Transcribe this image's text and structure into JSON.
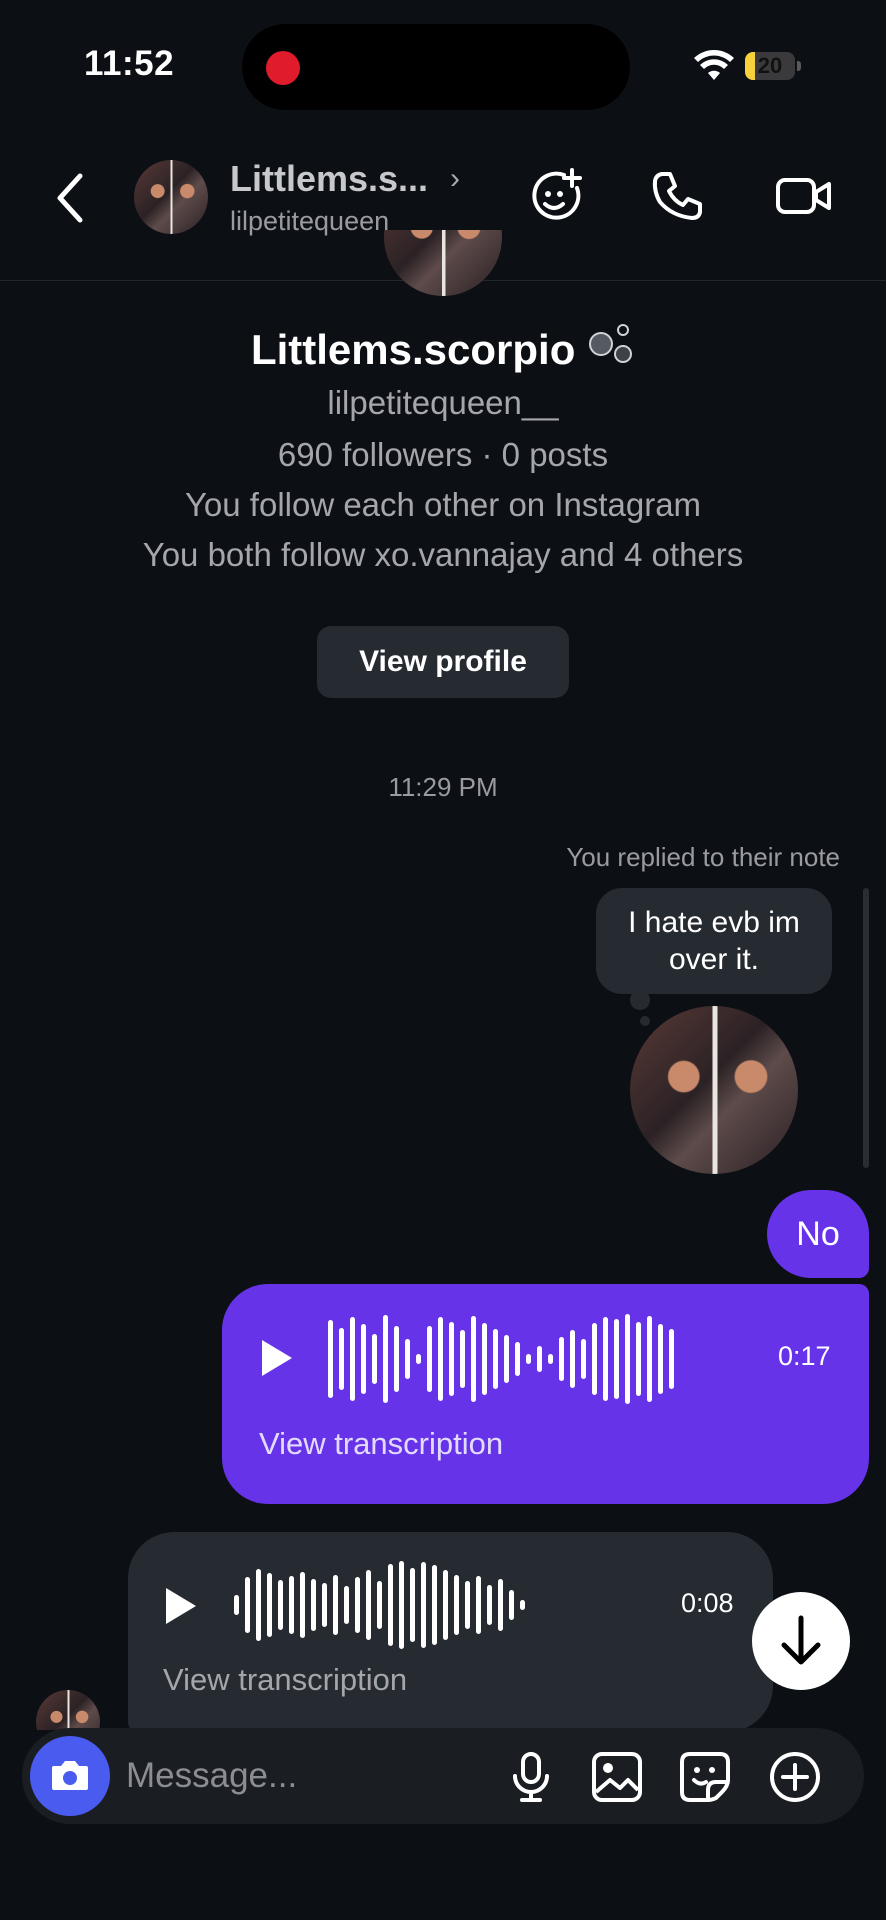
{
  "status_bar": {
    "time": "11:52",
    "battery": "20",
    "battery_level": 0.2
  },
  "header": {
    "name": "Littlems.s...",
    "chevron": "›",
    "username": "lilpetitequeen__",
    "icons": [
      "back-arrow-icon",
      "smiley-add-icon",
      "phone-icon",
      "video-camera-icon"
    ]
  },
  "profile": {
    "name": "Littlems.scorpio",
    "username": "lilpetitequeen__",
    "stats": "690 followers · 0 posts",
    "mutual_follow": "You follow each other on Instagram",
    "mutual_friends": "You both follow xo.vannajay and 4 others",
    "view_profile_label": "View profile"
  },
  "thread": {
    "timestamp": "11:29 PM",
    "note_caption": "You replied to their note",
    "note_text": "I hate evb im over it.",
    "sent_text": "No",
    "sent_voice": {
      "duration": "0:17",
      "transcription_label": "View transcription"
    },
    "received_voice": {
      "duration": "0:08",
      "transcription_label": "View transcription"
    }
  },
  "composer": {
    "placeholder": "Message...",
    "icons": [
      "camera-icon",
      "microphone-icon",
      "gallery-icon",
      "sticker-icon",
      "plus-icon"
    ]
  },
  "colors": {
    "accent": "#6733e9",
    "camera": "#4a5cf0",
    "background": "#0c0f14",
    "bubble_dark": "#262a31"
  }
}
